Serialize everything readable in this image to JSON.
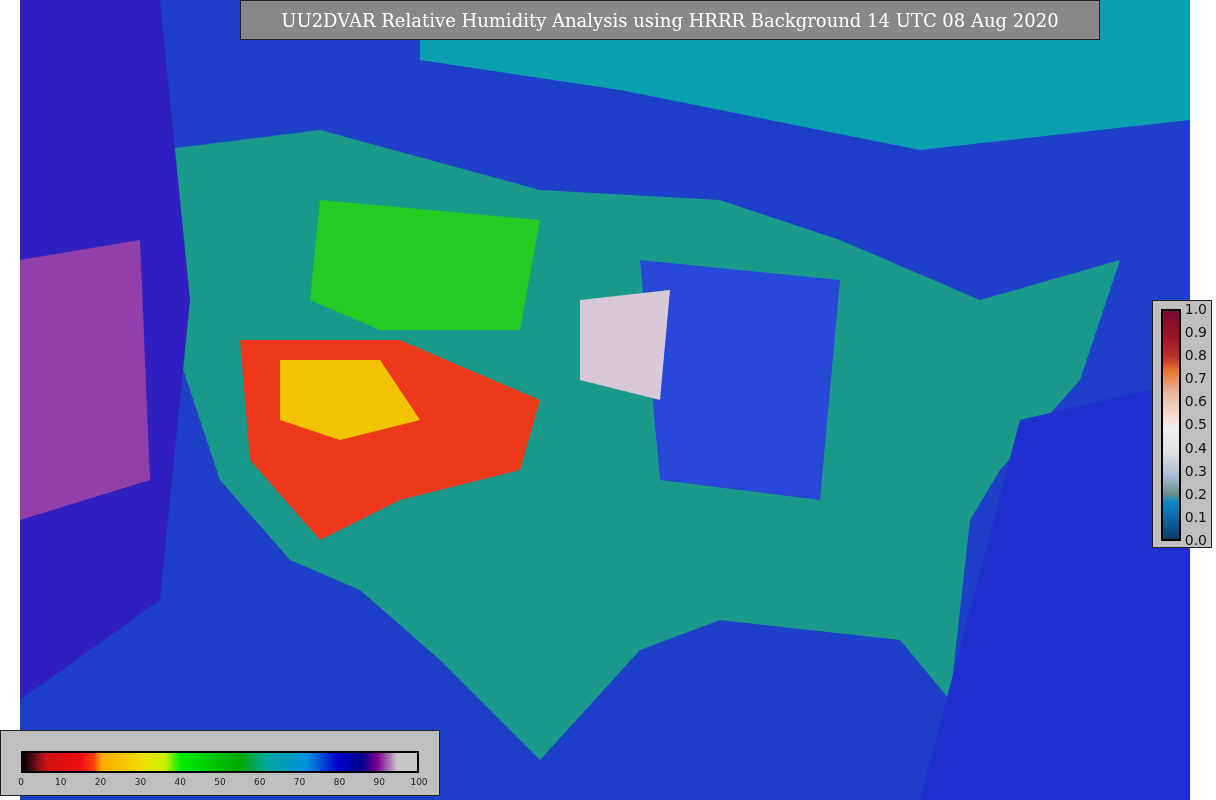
{
  "title": "UU2DVAR Relative Humidity Analysis using HRRR Background 14 UTC 08 Aug 2020",
  "humidity_colorbar": {
    "ticks": [
      "0",
      "10",
      "20",
      "30",
      "40",
      "50",
      "60",
      "70",
      "80",
      "90",
      "100"
    ]
  },
  "observation_colorbar": {
    "ticks": [
      "1.0",
      "0.9",
      "0.8",
      "0.7",
      "0.6",
      "0.5",
      "0.4",
      "0.3",
      "0.2",
      "0.1",
      "0.0"
    ]
  }
}
